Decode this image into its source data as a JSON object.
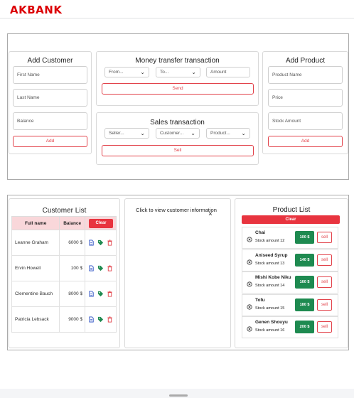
{
  "brand": {
    "logo_text": "AKBANK",
    "color": "#dc0005"
  },
  "add_customer": {
    "title": "Add Customer",
    "first_name_placeholder": "First Name",
    "last_name_placeholder": "Last Name",
    "balance_placeholder": "Balance",
    "add_label": "Add"
  },
  "money_transfer": {
    "title": "Money transfer transaction",
    "from_value": "From...",
    "to_value": "To...",
    "amount_placeholder": "Amount",
    "send_label": "Send"
  },
  "sales": {
    "title": "Sales transaction",
    "seller_value": "Seller...",
    "customer_value": "Customer...",
    "product_value": "Product...",
    "sell_label": "Sell"
  },
  "add_product": {
    "title": "Add Product",
    "name_placeholder": "Product Name",
    "price_placeholder": "Price",
    "stock_placeholder": "Stock Amount",
    "add_label": "Add"
  },
  "customer_list": {
    "title": "Customer List",
    "columns": [
      "Full name",
      "Balance"
    ],
    "clear_label": "Clear",
    "rows": [
      {
        "name": "Leanne Graham",
        "balance": "6000 $"
      },
      {
        "name": "Ervin Howell",
        "balance": "100 $"
      },
      {
        "name": "Clementine Bauch",
        "balance": "8000 $"
      },
      {
        "name": "Patricia Lebsack",
        "balance": "9000 $"
      }
    ]
  },
  "customer_info": {
    "hint": "Click to view customer information",
    "close_symbol": "×"
  },
  "product_list": {
    "title": "Product List",
    "clear_label": "Clear",
    "sell_label": "sell",
    "items": [
      {
        "name": "Chai",
        "stock": "Stock amount 12",
        "price": "100 $"
      },
      {
        "name": "Aniseed Syrup",
        "stock": "Stock amount 13",
        "price": "140 $"
      },
      {
        "name": "Mishi Kobe Niku",
        "stock": "Stock amount 14",
        "price": "160 $"
      },
      {
        "name": "Tofu",
        "stock": "Stock amount 15",
        "price": "180 $"
      },
      {
        "name": "Genen Shouyu",
        "stock": "Stock amount 16",
        "price": "200 $"
      }
    ]
  },
  "icons": {
    "doc": "document-icon",
    "tag": "tag-icon",
    "trash": "trash-icon",
    "delete_circle": "circle-x-icon"
  }
}
